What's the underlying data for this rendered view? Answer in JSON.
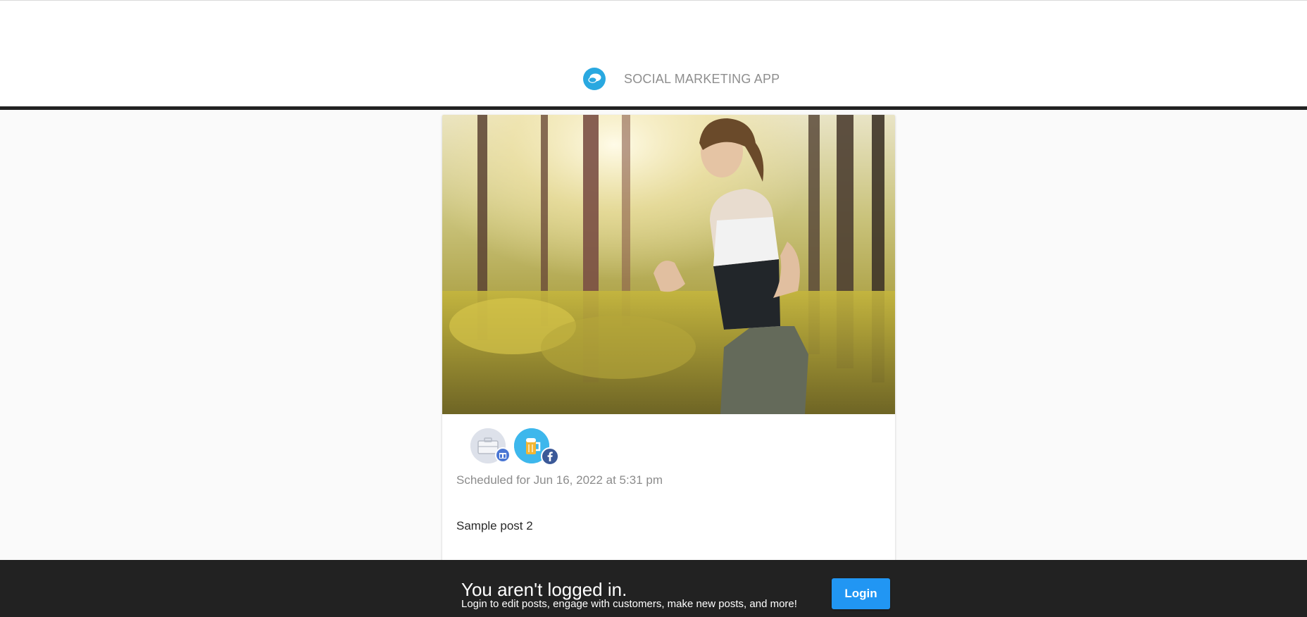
{
  "app": {
    "name": "SOCIAL MARKETING APP",
    "logo_icon": "chat-bubbles-icon",
    "accent": "#29a8e0"
  },
  "post": {
    "image_alt": "Woman running in a sunlit forest",
    "accounts": [
      {
        "icon": "briefcase-avatar-icon",
        "badge": "google-my-business-icon"
      },
      {
        "icon": "beer-mug-avatar-icon",
        "badge": "facebook-icon"
      }
    ],
    "schedule": "Scheduled for Jun 16, 2022 at 5:31 pm",
    "text": "Sample post 2"
  },
  "login_banner": {
    "title": "You aren't logged in.",
    "subtitle": "Login to edit posts, engage with customers, make new posts, and more!",
    "button_label": "Login",
    "button_color": "#2196f3",
    "background": "#222222"
  }
}
